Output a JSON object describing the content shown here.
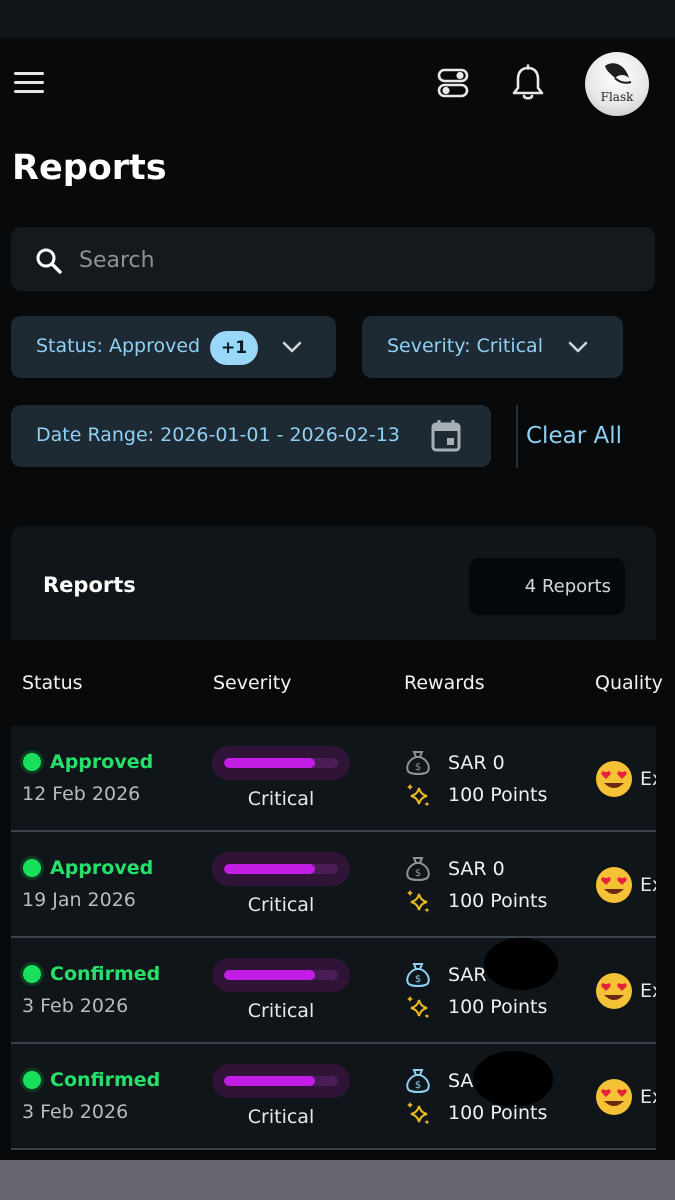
{
  "header": {
    "menu_icon": "hamburger-menu-icon",
    "filters_icon": "toggle-settings-icon",
    "notifications_icon": "bell-icon",
    "avatar_text": "Flask"
  },
  "page": {
    "title": "Reports"
  },
  "search": {
    "placeholder": "Search",
    "value": ""
  },
  "filters": {
    "status_label": "Status: Approved",
    "status_extra": "+1",
    "severity_label": "Severity: Critical",
    "date_range_label": "Date Range: 2026-01-01 - 2026-02-13",
    "clear_all": "Clear All"
  },
  "reports_card": {
    "title": "Reports",
    "count": "4 Reports"
  },
  "table": {
    "columns": [
      "Status",
      "Severity",
      "Rewards",
      "Quality"
    ],
    "rows": [
      {
        "status": "Approved",
        "date": "12 Feb 2026",
        "severity": "Critical",
        "severity_level": 0.8,
        "reward_money": "SAR 0",
        "reward_points": "100 Points",
        "quality": "Excellent",
        "money_redacted": false
      },
      {
        "status": "Approved",
        "date": "19 Jan 2026",
        "severity": "Critical",
        "severity_level": 0.8,
        "reward_money": "SAR 0",
        "reward_points": "100 Points",
        "quality": "Excellent",
        "money_redacted": false
      },
      {
        "status": "Confirmed",
        "date": "3 Feb 2026",
        "severity": "Critical",
        "severity_level": 0.8,
        "reward_money": "SAR",
        "reward_points": "100 Points",
        "quality": "Excellent",
        "money_redacted": true
      },
      {
        "status": "Confirmed",
        "date": "3 Feb 2026",
        "severity": "Critical",
        "severity_level": 0.8,
        "reward_money": "SA",
        "reward_points": "100 Points",
        "quality": "Excellent",
        "money_redacted": true
      }
    ]
  },
  "colors": {
    "accent": "#8fd0f4",
    "status_green": "#27e06a",
    "severity_purple": "#c21ee6",
    "background": "#07090b"
  }
}
